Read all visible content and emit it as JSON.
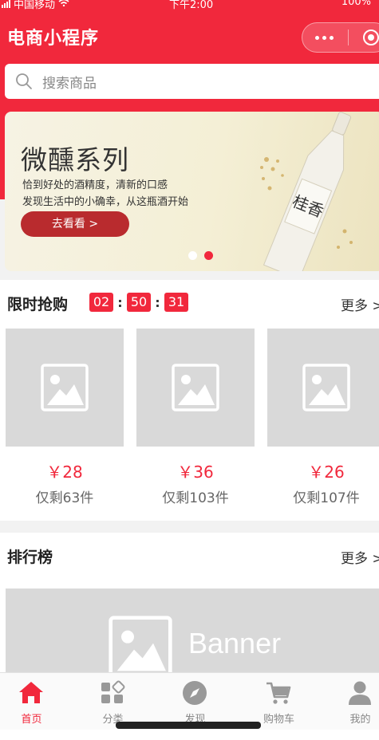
{
  "status_bar": {
    "carrier": "中国移动",
    "time": "下午2:00",
    "battery": "100%"
  },
  "nav": {
    "title": "电商小程序",
    "more_icon": "more-dots-icon",
    "close_icon": "target-icon"
  },
  "search": {
    "placeholder": "搜索商品"
  },
  "banner": {
    "title": "微醺系列",
    "line1": "恰到好处的酒精度，清新的口感",
    "line2": "发现生活中的小确幸，从这瓶酒开始",
    "button": "去看看 >",
    "bottle_label": "桂香",
    "dots_count": 2,
    "active_dot": 0
  },
  "flash_sale": {
    "title": "限时抢购",
    "timer": {
      "h": "02",
      "m": "50",
      "s": "31"
    },
    "more": "更多 >",
    "products": [
      {
        "price": "￥28",
        "stock": "仅剩63件"
      },
      {
        "price": "￥36",
        "stock": "仅剩103件"
      },
      {
        "price": "￥26",
        "stock": "仅剩107件"
      }
    ]
  },
  "ranking": {
    "title": "排行榜",
    "more": "更多 >",
    "banner_text": "Banner"
  },
  "tabbar": {
    "items": [
      {
        "label": "首页",
        "icon": "home-icon",
        "active": true
      },
      {
        "label": "分类",
        "icon": "category-icon",
        "active": false
      },
      {
        "label": "发现",
        "icon": "compass-icon",
        "active": false
      },
      {
        "label": "购物车",
        "icon": "cart-icon",
        "active": false
      },
      {
        "label": "我的",
        "icon": "user-icon",
        "active": false
      }
    ]
  },
  "colors": {
    "primary": "#f1283c",
    "banner_button": "#b92b2e",
    "placeholder": "#d9d9d9"
  }
}
